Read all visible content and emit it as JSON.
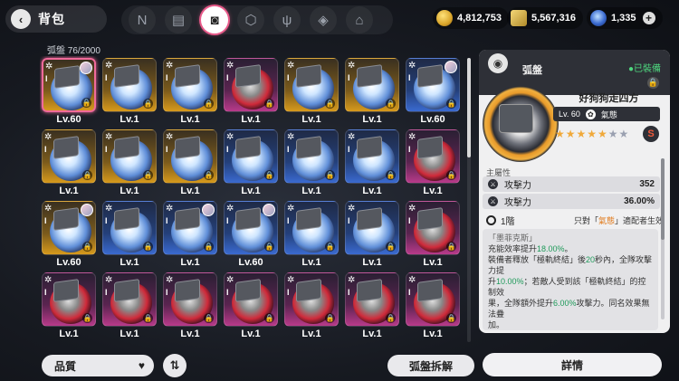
{
  "header": {
    "back_label": "背包",
    "tabs": [
      {
        "icon": "n-logo-icon",
        "glyph": "N"
      },
      {
        "icon": "device-icon",
        "glyph": "▤"
      },
      {
        "icon": "disc-box-icon",
        "glyph": "◙"
      },
      {
        "icon": "cube-icon",
        "glyph": "⬡"
      },
      {
        "icon": "utensils-icon",
        "glyph": "ψ"
      },
      {
        "icon": "module-icon",
        "glyph": "◈"
      },
      {
        "icon": "home-icon",
        "glyph": "⌂"
      }
    ],
    "active_tab": 2
  },
  "resources": [
    {
      "icon": "gold-coin-icon",
      "value": "4,812,753",
      "color": "#d9a52a"
    },
    {
      "icon": "ticket-icon",
      "value": "5,567,316",
      "color": "#c8a040"
    },
    {
      "icon": "crystal-icon",
      "value": "1,335",
      "color": "#3a6ad0"
    }
  ],
  "inventory": {
    "count_label": "弧盤",
    "count": "76/2000",
    "rows": [
      [
        {
          "lv": "Lv.60",
          "rarity": "gold",
          "selected": true,
          "avatar": true
        },
        {
          "lv": "Lv.1",
          "rarity": "gold"
        },
        {
          "lv": "Lv.1",
          "rarity": "gold"
        },
        {
          "lv": "Lv.1",
          "rarity": "pink"
        },
        {
          "lv": "Lv.1",
          "rarity": "gold"
        },
        {
          "lv": "Lv.1",
          "rarity": "gold"
        },
        {
          "lv": "Lv.60",
          "rarity": "blue",
          "avatar": true
        }
      ],
      [
        {
          "lv": "Lv.1",
          "rarity": "gold"
        },
        {
          "lv": "Lv.1",
          "rarity": "gold"
        },
        {
          "lv": "Lv.1",
          "rarity": "gold"
        },
        {
          "lv": "Lv.1",
          "rarity": "blue"
        },
        {
          "lv": "Lv.1",
          "rarity": "blue"
        },
        {
          "lv": "Lv.1",
          "rarity": "blue"
        },
        {
          "lv": "Lv.1",
          "rarity": "pink"
        }
      ],
      [
        {
          "lv": "Lv.60",
          "rarity": "gold",
          "avatar": true
        },
        {
          "lv": "Lv.1",
          "rarity": "blue"
        },
        {
          "lv": "Lv.1",
          "rarity": "blue",
          "avatar": true
        },
        {
          "lv": "Lv.60",
          "rarity": "blue",
          "avatar": true
        },
        {
          "lv": "Lv.1",
          "rarity": "blue"
        },
        {
          "lv": "Lv.1",
          "rarity": "blue"
        },
        {
          "lv": "Lv.1",
          "rarity": "pink"
        }
      ],
      [
        {
          "lv": "Lv.1",
          "rarity": "pink"
        },
        {
          "lv": "Lv.1",
          "rarity": "pink"
        },
        {
          "lv": "Lv.1",
          "rarity": "pink"
        },
        {
          "lv": "Lv.1",
          "rarity": "pink"
        },
        {
          "lv": "Lv.1",
          "rarity": "pink"
        },
        {
          "lv": "Lv.1",
          "rarity": "pink"
        },
        {
          "lv": "Lv.1",
          "rarity": "pink"
        }
      ]
    ]
  },
  "detail": {
    "type": "弧盤",
    "equipped": "●已裝備",
    "name": "好狗狗走四方",
    "level": "Lv. 60",
    "element": "氣態",
    "stars_full": "★★★★★",
    "stars_dim": "★★",
    "main_attr_title": "主屬性",
    "attrs": [
      {
        "label": "攻擊力",
        "value": "352"
      },
      {
        "label": "攻擊力",
        "value": "36.00%"
      }
    ],
    "tier": "1階",
    "cond_pre": "只對「",
    "cond_hl": "氣態",
    "cond_post": "」適配者生效",
    "effect_name": "「墨菲克斯」",
    "effect_lines": [
      {
        "t": "充能效率提升",
        "g": "18.00%",
        "e": "。"
      },
      {
        "t": "裝備者釋放「極軌終結」後",
        "g": "20",
        "e": "秒內，全隊攻擊力提"
      },
      {
        "t": "升",
        "g": "10.00%",
        "e": "；若敵人受到該「極軌終結」的控制效"
      },
      {
        "t": "果，全隊額外提升",
        "g": "6.00%",
        "e": "攻擊力。同名效果無法疊"
      },
      {
        "t": "加。",
        "g": "",
        "e": ""
      }
    ]
  },
  "controls": {
    "sort_label": "品質",
    "sort_order_glyph": "⇅",
    "decompose_label": "弧盤拆解",
    "details_label": "詳情"
  }
}
